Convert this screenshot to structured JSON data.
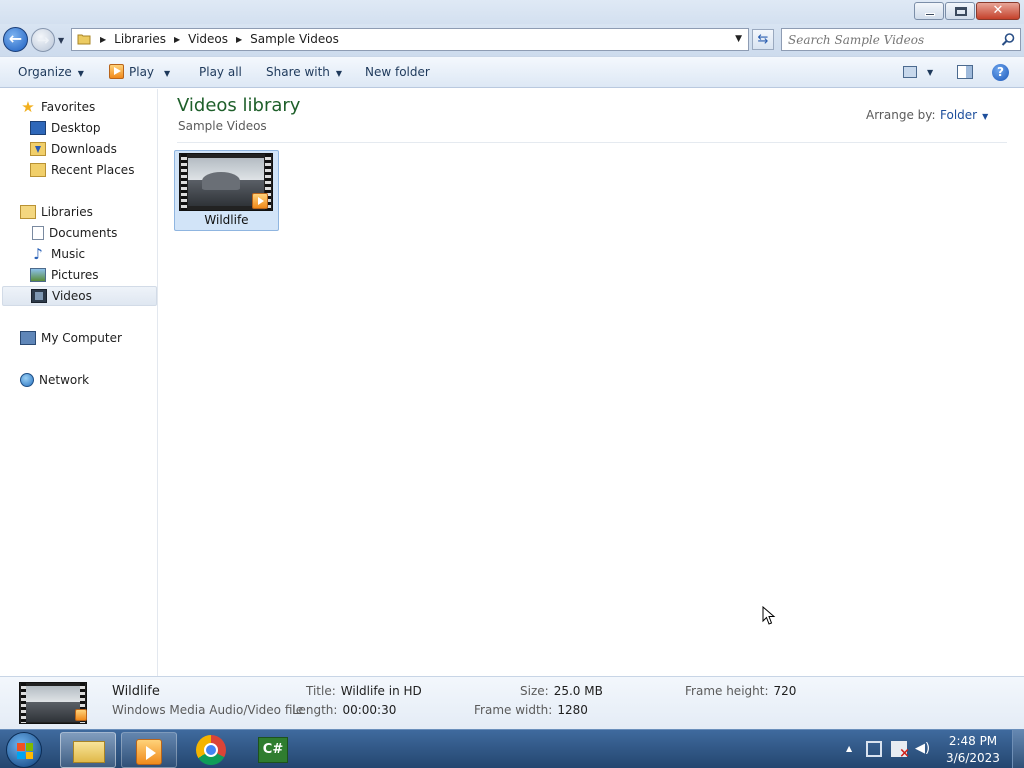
{
  "window": {
    "controls": {
      "minimize": "minimize",
      "maximize": "restore",
      "close": "x"
    }
  },
  "address": {
    "crumbs": [
      "Libraries",
      "Videos",
      "Sample Videos"
    ],
    "search_placeholder": "Search Sample Videos"
  },
  "toolbar": {
    "organize": "Organize",
    "play": "Play",
    "play_all": "Play all",
    "share_with": "Share with",
    "new_folder": "New folder"
  },
  "nav": {
    "favorites": {
      "label": "Favorites",
      "items": [
        "Desktop",
        "Downloads",
        "Recent Places"
      ]
    },
    "libraries": {
      "label": "Libraries",
      "items": [
        "Documents",
        "Music",
        "Pictures",
        "Videos"
      ]
    },
    "selected": "Videos",
    "computer": "My Computer",
    "network": "Network"
  },
  "content": {
    "title": "Videos library",
    "subtitle": "Sample Videos",
    "arrange_label": "Arrange by:",
    "arrange_value": "Folder",
    "items": [
      {
        "name": "Wildlife",
        "type": "video",
        "selected": true
      }
    ]
  },
  "details": {
    "name": "Wildlife",
    "file_type": "Windows Media Audio/Video file",
    "title_label": "Title:",
    "title_value": "Wildlife in HD",
    "length_label": "Length:",
    "length_value": "00:00:30",
    "size_label": "Size:",
    "size_value": "25.0 MB",
    "frame_width_label": "Frame width:",
    "frame_width_value": "1280",
    "frame_height_label": "Frame height:",
    "frame_height_value": "720"
  },
  "taskbar": {
    "clock_time": "2:48 PM",
    "clock_date": "3/6/2023",
    "close_glyph": "✕",
    "tasks": [
      "explorer-icon",
      "media-player-icon",
      "chrome-icon",
      "csharp-ide-icon"
    ],
    "csharp_label": "C#"
  },
  "colors": {
    "library_title": "#1e5f2a",
    "link_blue": "#1e4f9c",
    "selection": "#d2e4f8",
    "taskbar": "#2f5788"
  }
}
